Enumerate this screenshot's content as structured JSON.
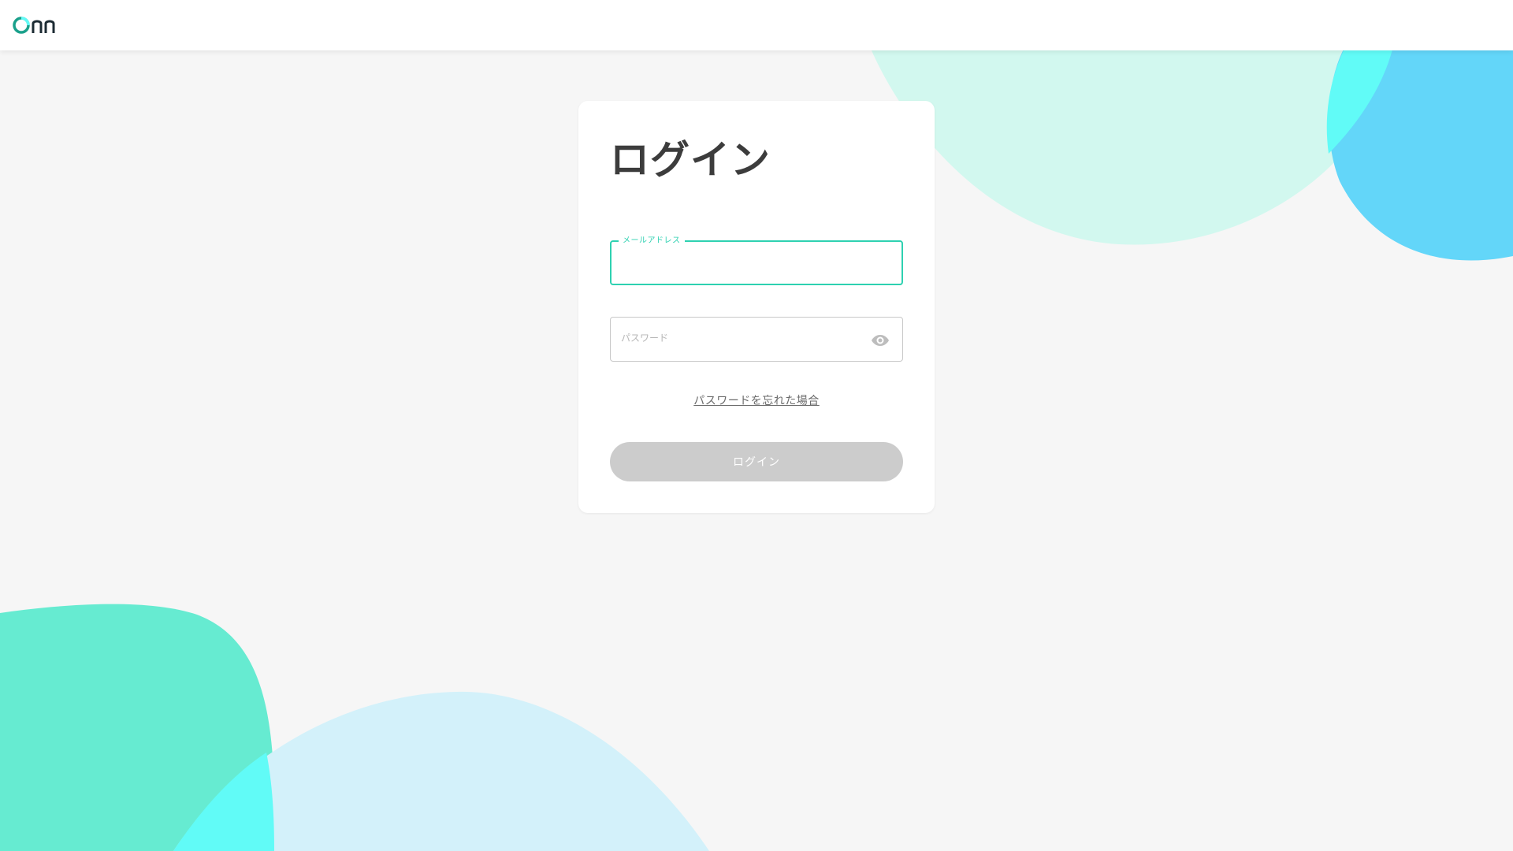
{
  "header": {
    "logo_text": "Onn"
  },
  "login": {
    "title": "ログイン",
    "email": {
      "label": "メールアドレス",
      "value": ""
    },
    "password": {
      "placeholder": "パスワード",
      "value": ""
    },
    "forgot_link": "パスワードを忘れた場合",
    "submit_label": "ログイン"
  },
  "colors": {
    "accent": "#2ed1b1",
    "button_disabled": "#cccccc",
    "background": "#f6f6f6",
    "blob_mint_light": "#d2f8ef",
    "blob_blue": "#63d6f9",
    "blob_cyan": "#61fbf7",
    "blob_green": "#66ebd1",
    "blob_sky": "#d3f1fa"
  },
  "icons": {
    "password_toggle": "eye-icon"
  }
}
